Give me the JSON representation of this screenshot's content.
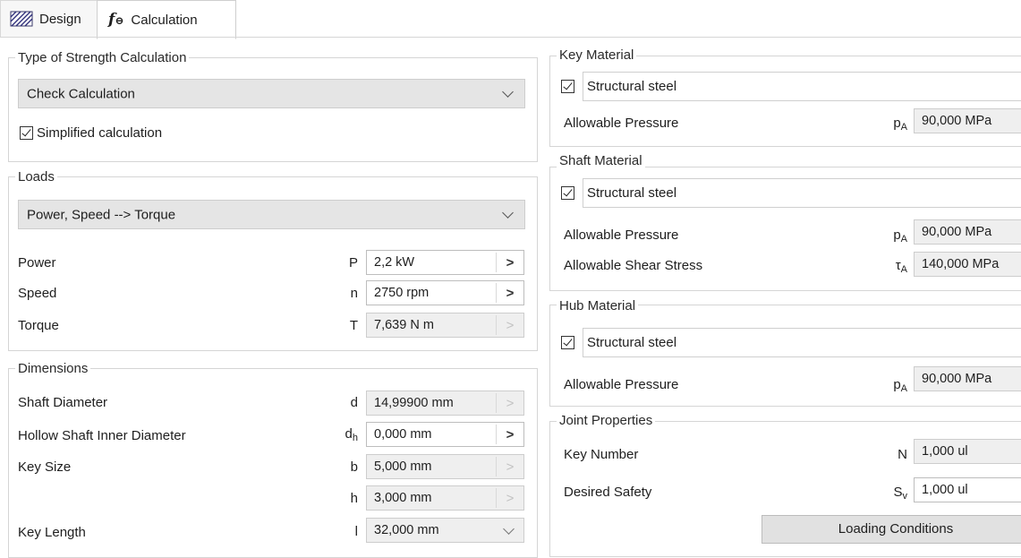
{
  "tabs": [
    {
      "label": "Design",
      "icon": "design-hatch-icon",
      "active": false
    },
    {
      "label": "Calculation",
      "icon": "fx-calculation-icon",
      "active": true
    }
  ],
  "strength": {
    "title": "Type of Strength Calculation",
    "selected": "Check Calculation",
    "simplified_label": "Simplified calculation",
    "simplified_checked": true
  },
  "loads": {
    "title": "Loads",
    "selected": "Power, Speed --> Torque",
    "rows": [
      {
        "label": "Power",
        "symbol": "P",
        "value": "2,2 kW",
        "enabled": true
      },
      {
        "label": "Speed",
        "symbol": "n",
        "value": "2750 rpm",
        "enabled": true
      },
      {
        "label": "Torque",
        "symbol": "T",
        "value": "7,639 N m",
        "enabled": false
      }
    ]
  },
  "dimensions": {
    "title": "Dimensions",
    "rows": [
      {
        "label": "Shaft Diameter",
        "symbol": "d",
        "sub": "",
        "value": "14,99900 mm",
        "enabled": false,
        "control": "arrow"
      },
      {
        "label": "Hollow Shaft Inner Diameter",
        "symbol": "d",
        "sub": "h",
        "value": "0,000 mm",
        "enabled": true,
        "control": "arrow"
      },
      {
        "label": "Key Size",
        "symbol": "b",
        "sub": "",
        "value": "5,000 mm",
        "enabled": false,
        "control": "arrow"
      },
      {
        "label": "",
        "symbol": "h",
        "sub": "",
        "value": "3,000 mm",
        "enabled": false,
        "control": "arrow"
      },
      {
        "label": "Key Length",
        "symbol": "l",
        "sub": "",
        "value": "32,000 mm",
        "enabled": false,
        "control": "dropdown"
      }
    ]
  },
  "key_material": {
    "title": "Key Material",
    "material": "Structural steel",
    "checked": true,
    "rows": [
      {
        "label": "Allowable Pressure",
        "symbol": "p",
        "sub": "A",
        "value": "90,000 MPa"
      }
    ]
  },
  "shaft_material": {
    "title": "Shaft Material",
    "material": "Structural steel",
    "checked": true,
    "rows": [
      {
        "label": "Allowable Pressure",
        "symbol": "p",
        "sub": "A",
        "value": "90,000 MPa"
      },
      {
        "label": "Allowable Shear Stress",
        "symbol": "τ",
        "sub": "A",
        "value": "140,000 MPa"
      }
    ]
  },
  "hub_material": {
    "title": "Hub Material",
    "material": "Structural steel",
    "checked": true,
    "rows": [
      {
        "label": "Allowable Pressure",
        "symbol": "p",
        "sub": "A",
        "value": "90,000 MPa"
      }
    ]
  },
  "joint": {
    "title": "Joint Properties",
    "rows": [
      {
        "label": "Key Number",
        "symbol": "N",
        "sub": "",
        "value": "1,000 ul",
        "enabled": false
      },
      {
        "label": "Desired Safety",
        "symbol": "S",
        "sub": "v",
        "value": "1,000 ul",
        "enabled": true
      }
    ],
    "button": "Loading Conditions"
  }
}
